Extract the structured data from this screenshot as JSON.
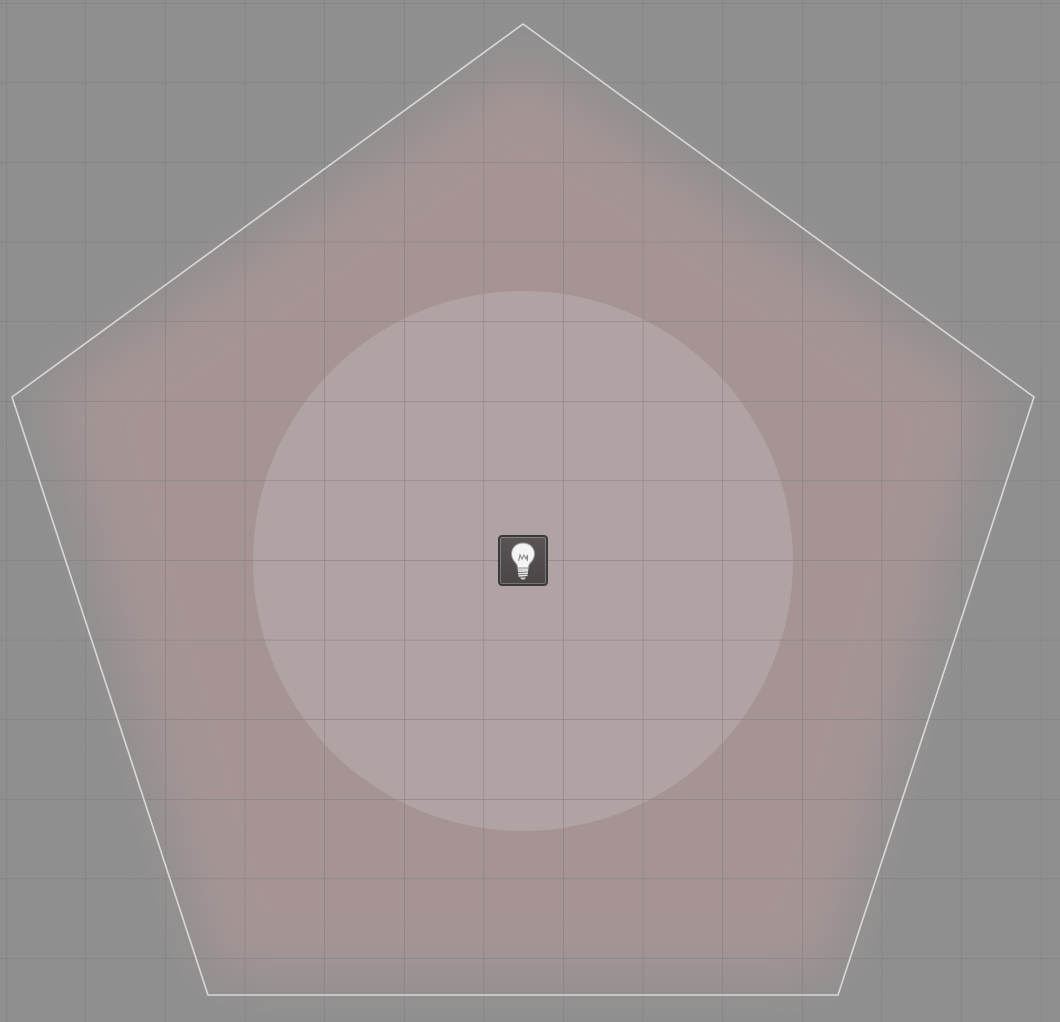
{
  "scene": {
    "background_color": "#8f8f8f",
    "grid_color": "#7d7d7d",
    "light_area_border_color": "#d8d8d8",
    "dim_light_color": "#a89595",
    "bright_light_color": "#b3a6a6"
  },
  "light_source": {
    "icon": "lightbulb-icon",
    "token_color": "#4f4a4c"
  }
}
